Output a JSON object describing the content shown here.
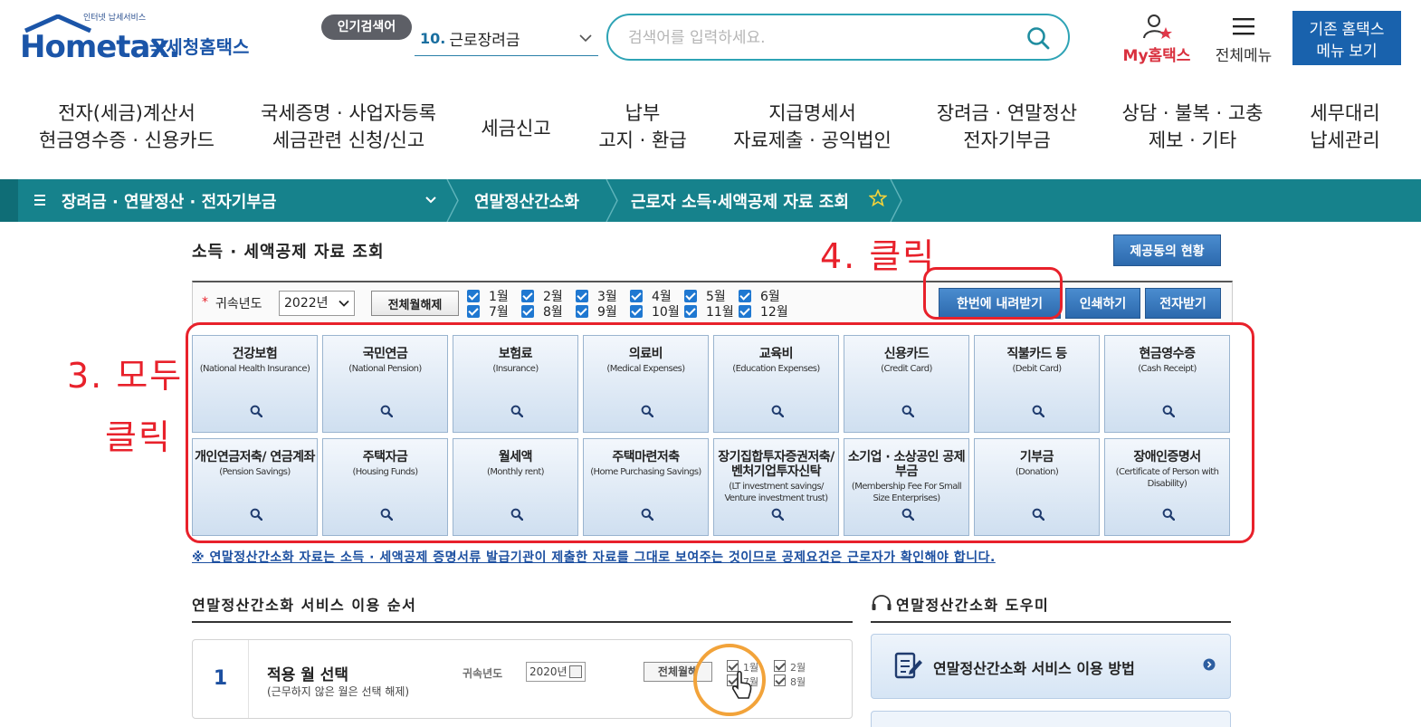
{
  "header": {
    "logo_small": "인터넷 납세서비스",
    "logo_main": "Hometax.",
    "logo_kor": "국세청홈택스",
    "popular_badge": "인기검색어",
    "popular_num": "10.",
    "popular_term": "근로장려금",
    "search_placeholder": "검색어를 입력하세요.",
    "my_hometax": "My홈택스",
    "all_menu": "전체메뉴",
    "legacy_line1": "기존 홈택스",
    "legacy_line2": "메뉴 보기"
  },
  "gnb": [
    {
      "line1": "전자(세금)계산서",
      "line2": "현금영수증 · 신용카드"
    },
    {
      "line1": "국세증명 · 사업자등록",
      "line2": "세금관련 신청/신고"
    },
    {
      "line1": "세금신고",
      "line2": ""
    },
    {
      "line1": "납부",
      "line2": "고지 · 환급"
    },
    {
      "line1": "지급명세서",
      "line2": "자료제출 · 공익법인"
    },
    {
      "line1": "장려금 · 연말정산",
      "line2": "전자기부금"
    },
    {
      "line1": "상담 · 불복 · 고충",
      "line2": "제보 · 기타"
    },
    {
      "line1": "세무대리",
      "line2": "납세관리"
    }
  ],
  "lnb": {
    "category": "장려금 · 연말정산 · 전자기부금",
    "sub": "연말정산간소화",
    "page": "근로자 소득·세액공제 자료 조회"
  },
  "content": {
    "title": "소득 · 세액공제 자료 조회",
    "provider_btn": "제공동의 현황",
    "year_label": "귀속년도",
    "year_value": "2022년",
    "reset_btn": "전체월해제",
    "months": [
      "1월",
      "2월",
      "3월",
      "4월",
      "5월",
      "6월",
      "7월",
      "8월",
      "9월",
      "10월",
      "11월",
      "12월"
    ],
    "download_btn": "한번에 내려받기",
    "print_btn": "인쇄하기",
    "einvoice_btn": "전자받기",
    "notice": "※ 연말정산간소화 자료는 소득 · 세액공제 증명서류 발급기관이 제출한 자료를 그대로 보여주는 것이므로 공제요건은 근로자가 확인해야 합니다."
  },
  "annotations": {
    "step4": "4. 클릭",
    "step3_line1": "3. 모두",
    "step3_line2": "클릭"
  },
  "tiles": [
    {
      "title": "건강보험",
      "sub": "(National Health Insurance)"
    },
    {
      "title": "국민연금",
      "sub": "(National Pension)"
    },
    {
      "title": "보험료",
      "sub": "(Insurance)"
    },
    {
      "title": "의료비",
      "sub": "(Medical Expenses)"
    },
    {
      "title": "교육비",
      "sub": "(Education Expenses)"
    },
    {
      "title": "신용카드",
      "sub": "(Credit Card)"
    },
    {
      "title": "직불카드 등",
      "sub": "(Debit Card)"
    },
    {
      "title": "현금영수증",
      "sub": "(Cash Receipt)"
    },
    {
      "title": "개인연금저축/ 연금계좌",
      "sub": "(Pension Savings)"
    },
    {
      "title": "주택자금",
      "sub": "(Housing Funds)"
    },
    {
      "title": "월세액",
      "sub": "(Monthly rent)"
    },
    {
      "title": "주택마련저축",
      "sub": "(Home Purchasing Savings)"
    },
    {
      "title": "장기집합투자증권저축/ 벤처기업투자신탁",
      "sub": "(LT investment savings/ Venture investment trust)"
    },
    {
      "title": "소기업 · 소상공인 공제부금",
      "sub": "(Membership Fee For Small Size Enterprises)"
    },
    {
      "title": "기부금",
      "sub": "(Donation)"
    },
    {
      "title": "장애인증명서",
      "sub": "(Certificate of Person with Disability)"
    }
  ],
  "guide": {
    "title": "연말정산간소화 서비스 이용 순서",
    "step_num": "1",
    "step_title": "적용 월 선택",
    "step_desc": "(근무하지 않은 월은 선택 해제)",
    "preview_label": "귀속년도",
    "preview_year": "2020년",
    "preview_btn": "전체월해",
    "preview_m1": "1월",
    "preview_m7": "7월",
    "preview_m2": "2월",
    "preview_m8": "8월"
  },
  "helper": {
    "title": "연말정산간소화 도우미",
    "card1": "연말정산간소화 서비스 이용 방법"
  }
}
